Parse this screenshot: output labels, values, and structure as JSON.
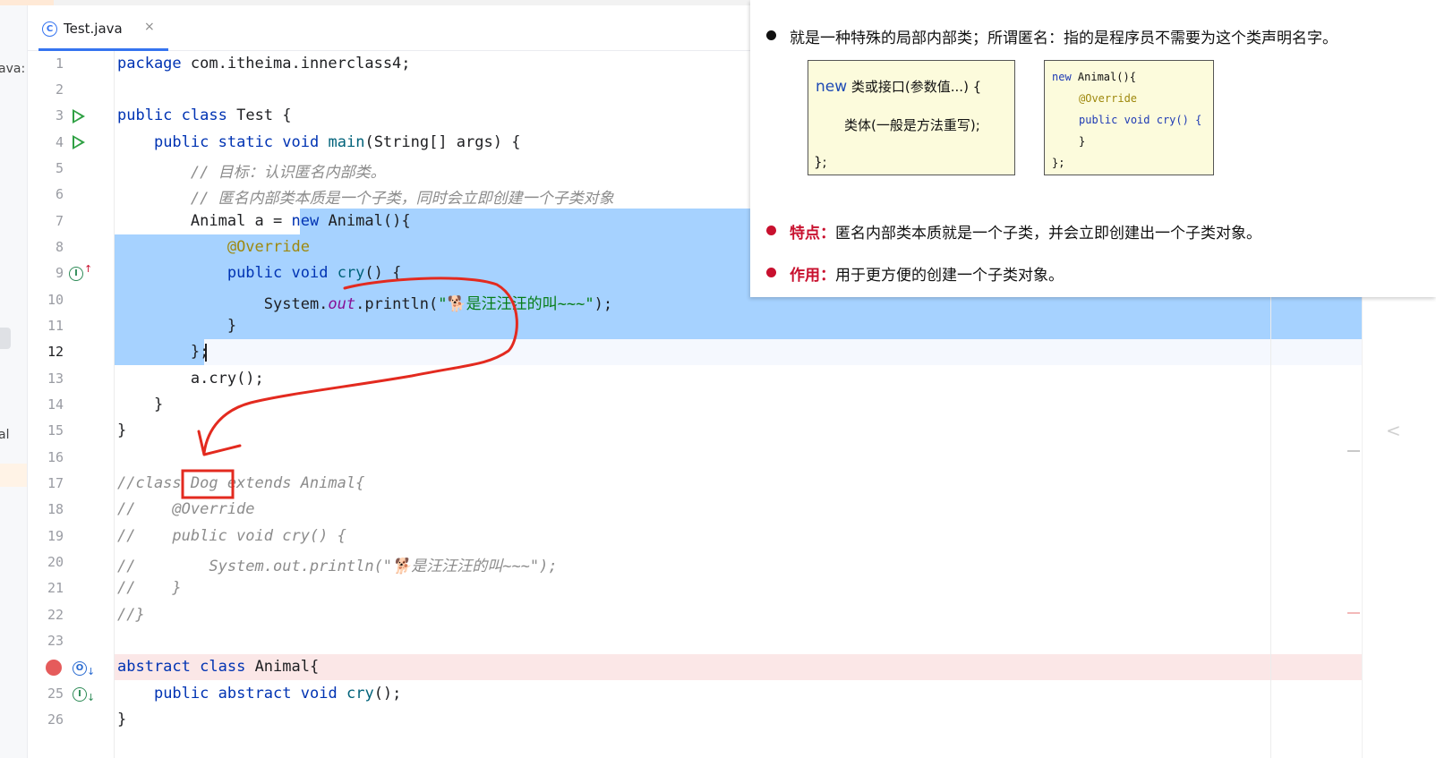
{
  "left_panel": {
    "clipped_texts": [
      "ava:",
      "al"
    ]
  },
  "tab": {
    "icon": "class-c-icon",
    "icon_glyph": "C",
    "label": "Test.java",
    "close": "×"
  },
  "line_numbers": [
    "1",
    "2",
    "3",
    "4",
    "5",
    "6",
    "7",
    "8",
    "9",
    "10",
    "11",
    "12",
    "13",
    "14",
    "15",
    "16",
    "17",
    "18",
    "19",
    "20",
    "21",
    "22",
    "23",
    "",
    "25",
    "26"
  ],
  "code": {
    "l1": {
      "kw": "package",
      "rest": " com.itheima.innerclass4;"
    },
    "l3": {
      "kw1": "public",
      "kw2": "class",
      "rest": " Test {"
    },
    "l4": {
      "indent": "    ",
      "kw1": "public",
      "kw2": "static",
      "kw3": "void",
      "fn": "main",
      "rest": "(String[] args) {"
    },
    "l5": {
      "indent": "        ",
      "text": "// 目标：认识匿名内部类。"
    },
    "l6": {
      "indent": "        ",
      "text": "// 匿名内部类本质是一个子类，同时会立即创建一个子类对象"
    },
    "l7": {
      "indent": "        ",
      "pre": "Animal a = ",
      "kw": "new",
      "rest": " Animal(){"
    },
    "l8": {
      "indent": "            ",
      "ann": "@Override"
    },
    "l9": {
      "indent": "            ",
      "kw1": "public",
      "kw2": "void",
      "fn": "cry",
      "rest": "() {"
    },
    "l10": {
      "indent": "                ",
      "pre": "System.",
      "st": "out",
      "mid": ".println(",
      "str": "\"🐕是汪汪汪的叫~~~\"",
      "rest": ");"
    },
    "l11": {
      "indent": "            ",
      "text": "}"
    },
    "l12": {
      "indent": "        ",
      "text": "};"
    },
    "l13": {
      "indent": "        ",
      "text": "a.cry();"
    },
    "l14": {
      "indent": "    ",
      "text": "}"
    },
    "l15": {
      "text": "}"
    },
    "l17": {
      "text": "//class Dog extends Animal{"
    },
    "l18": {
      "text": "//    @Override"
    },
    "l19": {
      "text": "//    public void cry() {"
    },
    "l20": {
      "text": "//        System.out.println(\"🐕是汪汪汪的叫~~~\");"
    },
    "l21": {
      "text": "//    }"
    },
    "l22": {
      "text": "//}"
    },
    "l24": {
      "kw1": "abstract",
      "kw2": "class",
      "rest": " Animal{"
    },
    "l25": {
      "indent": "    ",
      "kw1": "public",
      "kw2": "abstract",
      "kw3": "void",
      "fn": "cry",
      "rest": "();"
    },
    "l26": {
      "text": "}"
    }
  },
  "gutter_icons": {
    "run": "run-icon",
    "implement_up": "implementing-method-icon",
    "implemented_down": "implemented-method-icon",
    "breakpoint": "breakpoint-icon",
    "i_glyph": "I",
    "o_glyph": "O",
    "up_arrow": "↑",
    "down_arrow": "↓"
  },
  "slide": {
    "bullet1": "就是一种特殊的局部内部类；所谓匿名：指的是程序员不需要为这个类声明名字。",
    "box1": {
      "line1_new": "new",
      "line1_rest": " 类或接口(参数值...) {",
      "line2": "类体(一般是方法重写);",
      "line3": "};"
    },
    "box2": {
      "line1_kw": "new",
      "line1_rest": " Animal(){",
      "line2_ann": "@Override",
      "line3_kw1": "public",
      "line3_kw2": "void",
      "line3_rest": " cry() {",
      "line4": "}",
      "line5": "};"
    },
    "bullet2": {
      "lead": "特点：",
      "text": "匿名内部类本质就是一个子类，并会立即创建出一个子类对象。"
    },
    "bullet3": {
      "lead": "作用：",
      "text": "用于更方便的创建一个子类对象。"
    }
  },
  "colors": {
    "keyword": "#0033b3",
    "function": "#00627a",
    "annotation": "#9e880d",
    "string": "#067d17",
    "comment": "#8c8c8c",
    "selection": "#a6d2ff",
    "breakpoint": "#e55b5b",
    "annotation_ink": "#e32a1f"
  }
}
